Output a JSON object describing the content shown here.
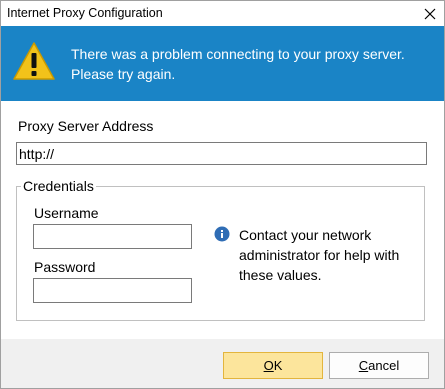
{
  "window": {
    "title": "Internet Proxy Configuration"
  },
  "banner": {
    "message": "There was a problem connecting to your proxy server. Please try again."
  },
  "proxy": {
    "label": "Proxy Server Address",
    "value": "http://"
  },
  "credentials": {
    "legend": "Credentials",
    "username_label": "Username",
    "username_value": "",
    "password_label": "Password",
    "password_value": "",
    "info_text": "Contact your network administrator for help with these values."
  },
  "buttons": {
    "ok": {
      "accel": "O",
      "rest": "K"
    },
    "cancel": {
      "accel": "C",
      "rest": "ancel"
    }
  },
  "colors": {
    "banner": "#1a84c6",
    "ok_button": "#fce59c",
    "info_icon": "#2f6db5"
  }
}
